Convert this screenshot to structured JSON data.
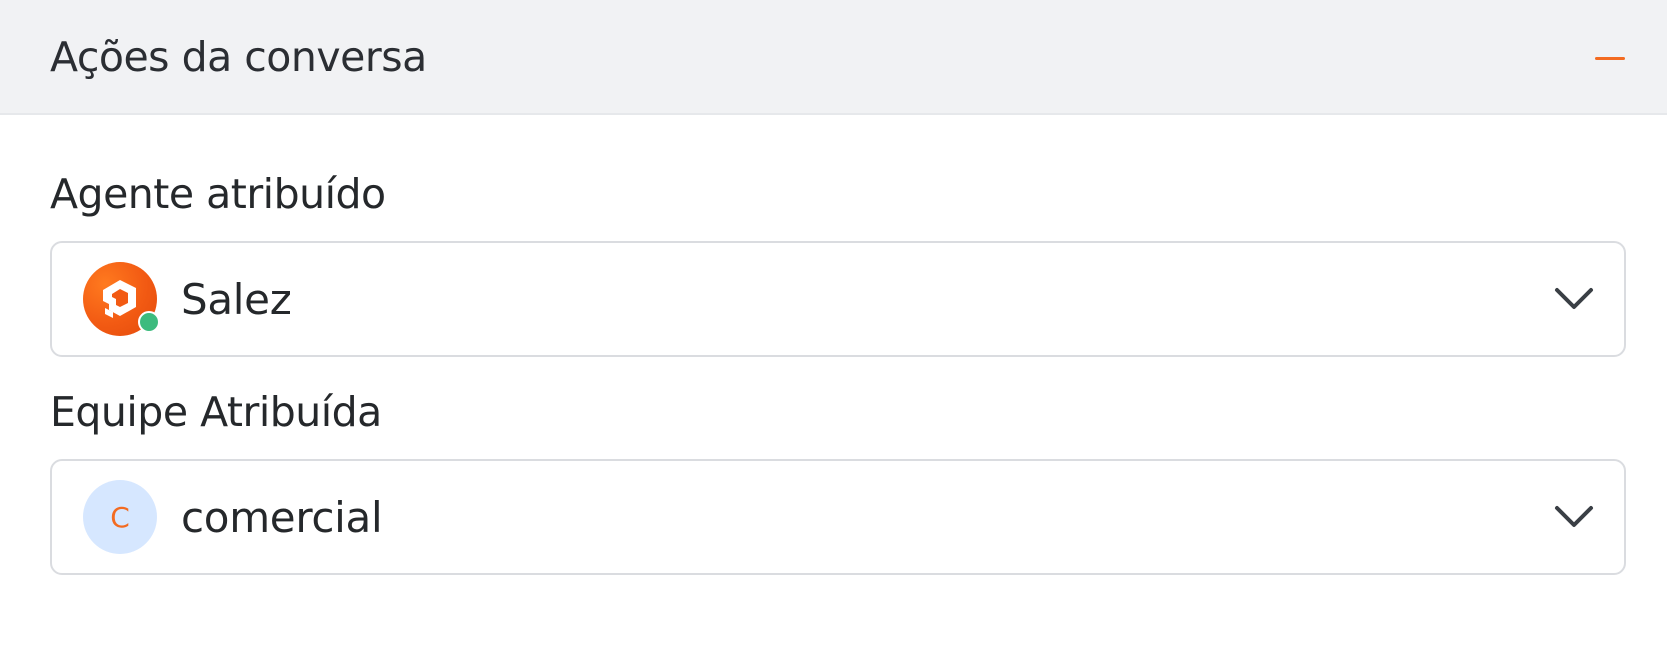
{
  "header": {
    "title": "Ações da conversa",
    "collapse_icon": "minus-icon",
    "accent_color": "#f36b21"
  },
  "agent": {
    "label": "Agente atribuído",
    "selected": "Salez",
    "avatar_icon": "salez-logo-icon",
    "status": "online",
    "status_color": "#3dbb7e"
  },
  "team": {
    "label": "Equipe Atribuída",
    "selected": "comercial",
    "avatar_initial": "C"
  },
  "icons": {
    "dropdown": "chevron-down-icon"
  }
}
